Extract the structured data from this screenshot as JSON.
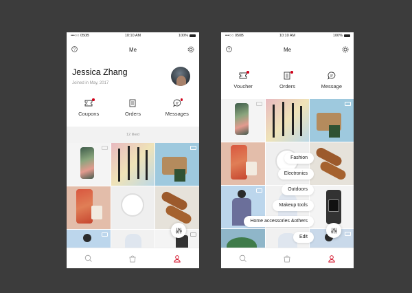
{
  "status": {
    "carrier": "•••○○ 050B",
    "time": "10:10 AM",
    "battery": "100%"
  },
  "screen1": {
    "title": "Me",
    "name": "Jessica Zhang",
    "joined": "Joined in May, 2017",
    "quick_actions": [
      {
        "label": "Coupons",
        "icon": "coupon-icon"
      },
      {
        "label": "Orders",
        "icon": "orders-icon"
      },
      {
        "label": "Messages",
        "icon": "message-icon"
      }
    ],
    "liked": "12 liked"
  },
  "screen2": {
    "title": "Me",
    "quick_actions": [
      {
        "label": "Voucher",
        "icon": "coupon-icon"
      },
      {
        "label": "Orders",
        "icon": "orders-icon"
      },
      {
        "label": "Message",
        "icon": "message-icon"
      }
    ],
    "filter_menu": [
      "Fashion",
      "Electronics",
      "Outdoors",
      "Makeup tools",
      "Home accessories &others",
      "Edit"
    ]
  },
  "tabs": [
    {
      "name": "search-tab",
      "icon": "search-icon"
    },
    {
      "name": "bag-tab",
      "icon": "bag-icon"
    },
    {
      "name": "profile-tab",
      "icon": "person-icon"
    }
  ],
  "colors": {
    "accent": "#d0021b",
    "background": "#3c3c3c"
  }
}
